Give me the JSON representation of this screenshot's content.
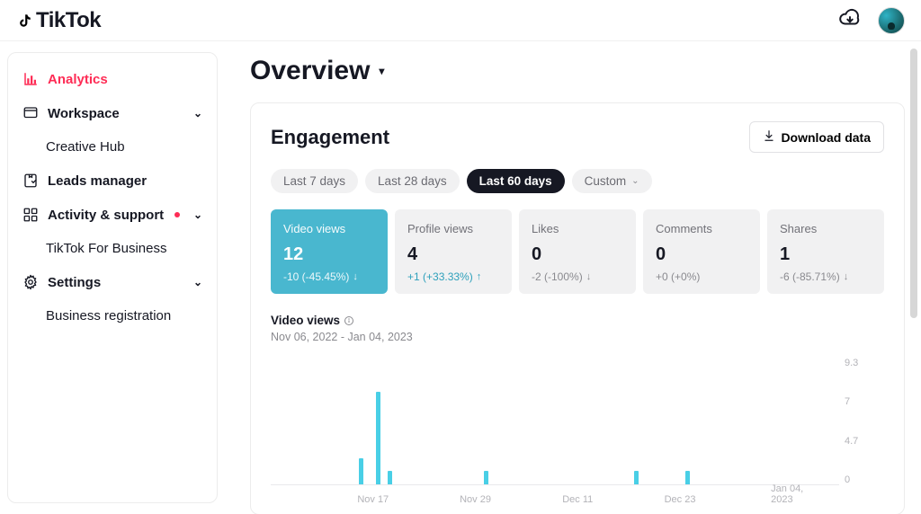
{
  "brand": {
    "name": "TikTok"
  },
  "sidebar": {
    "items": [
      {
        "label": "Analytics",
        "active": true,
        "icon": "chart-icon"
      },
      {
        "label": "Workspace",
        "expandable": true,
        "icon": "workspace-icon"
      },
      {
        "label": "Leads manager",
        "icon": "leads-icon"
      },
      {
        "label": "Activity & support",
        "expandable": true,
        "dot": true,
        "icon": "activity-icon"
      },
      {
        "label": "Settings",
        "expandable": true,
        "icon": "settings-icon"
      }
    ],
    "subitems": {
      "workspace": [
        {
          "label": "Creative Hub"
        }
      ],
      "activity": [
        {
          "label": "TikTok For Business",
          "dot": true
        }
      ],
      "settings": [
        {
          "label": "Business registration"
        }
      ]
    }
  },
  "page": {
    "title": "Overview"
  },
  "engagement": {
    "title": "Engagement",
    "download_label": "Download data",
    "ranges": [
      {
        "label": "Last 7 days"
      },
      {
        "label": "Last 28 days"
      },
      {
        "label": "Last 60 days",
        "active": true
      },
      {
        "label": "Custom",
        "hasChevron": true
      }
    ],
    "metrics": [
      {
        "key": "video_views",
        "label": "Video views",
        "value": "12",
        "delta": "-10 (-45.45%)",
        "direction": "down",
        "active": true
      },
      {
        "key": "profile_views",
        "label": "Profile views",
        "value": "4",
        "delta": "+1 (+33.33%)",
        "direction": "up"
      },
      {
        "key": "likes",
        "label": "Likes",
        "value": "0",
        "delta": "-2 (-100%)",
        "direction": "down"
      },
      {
        "key": "comments",
        "label": "Comments",
        "value": "0",
        "delta": "+0 (+0%)",
        "direction": "neutral"
      },
      {
        "key": "shares",
        "label": "Shares",
        "value": "1",
        "delta": "-6 (-85.71%)",
        "direction": "down"
      }
    ],
    "chart": {
      "title": "Video views",
      "date_range": "Nov 06, 2022 - Jan 04, 2023"
    }
  },
  "chart_data": {
    "type": "bar",
    "title": "Video views",
    "subtitle": "Nov 06, 2022 - Jan 04, 2023",
    "xlabel": "",
    "ylabel": "",
    "ylim": [
      0,
      9.3
    ],
    "y_ticks": [
      9.3,
      7,
      4.7,
      0
    ],
    "x_ticks": [
      "Nov 17",
      "Nov 29",
      "Dec 11",
      "Dec 23",
      "Jan 04, 2023"
    ],
    "x_tick_positions_pct": [
      18,
      36,
      54,
      72,
      92
    ],
    "bars": [
      {
        "x_pct": 15.5,
        "value": 2
      },
      {
        "x_pct": 18.5,
        "value": 7
      },
      {
        "x_pct": 20.5,
        "value": 1
      },
      {
        "x_pct": 37.5,
        "value": 1
      },
      {
        "x_pct": 64.0,
        "value": 1
      },
      {
        "x_pct": 73.0,
        "value": 1
      }
    ]
  }
}
